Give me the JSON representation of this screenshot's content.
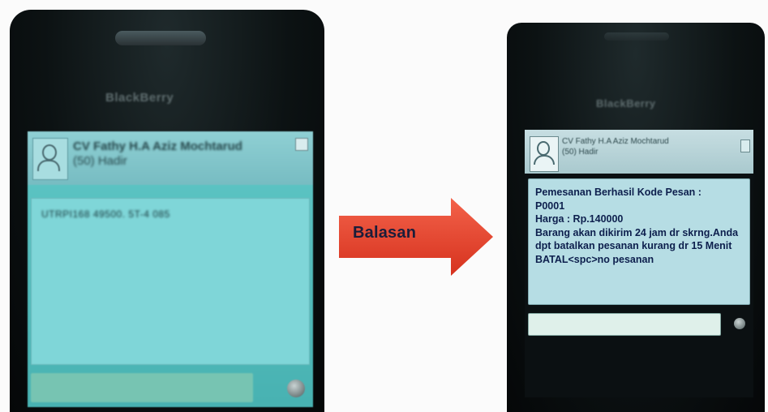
{
  "left_phone": {
    "brand": "BlackBerry",
    "contact_name": "CV Fathy H.A Aziz Mochtarud",
    "contact_status": "(50) Hadir",
    "sent_message": "UTRPI168 49500. 5T-4 085"
  },
  "arrow": {
    "label": "Balasan",
    "color": "#e8462e"
  },
  "right_phone": {
    "brand": "BlackBerry",
    "contact_name": "CV Fathy H.A Aziz Mochtarud",
    "contact_status": "(50) Hadir",
    "reply_message": "Pemesanan Berhasil Kode Pesan :\nP0001\nHarga : Rp.140000\nBarang akan dikirim 24 jam dr skrng.Anda dpt batalkan pesanan kurang dr 15 Menit\nBATAL<spc>no pesanan"
  },
  "colors": {
    "screen_left": "#5fc7c6",
    "reply_bubble": "#b6dde4",
    "reply_text": "#0d1f4d",
    "arrow_fill": "#e8462e"
  }
}
